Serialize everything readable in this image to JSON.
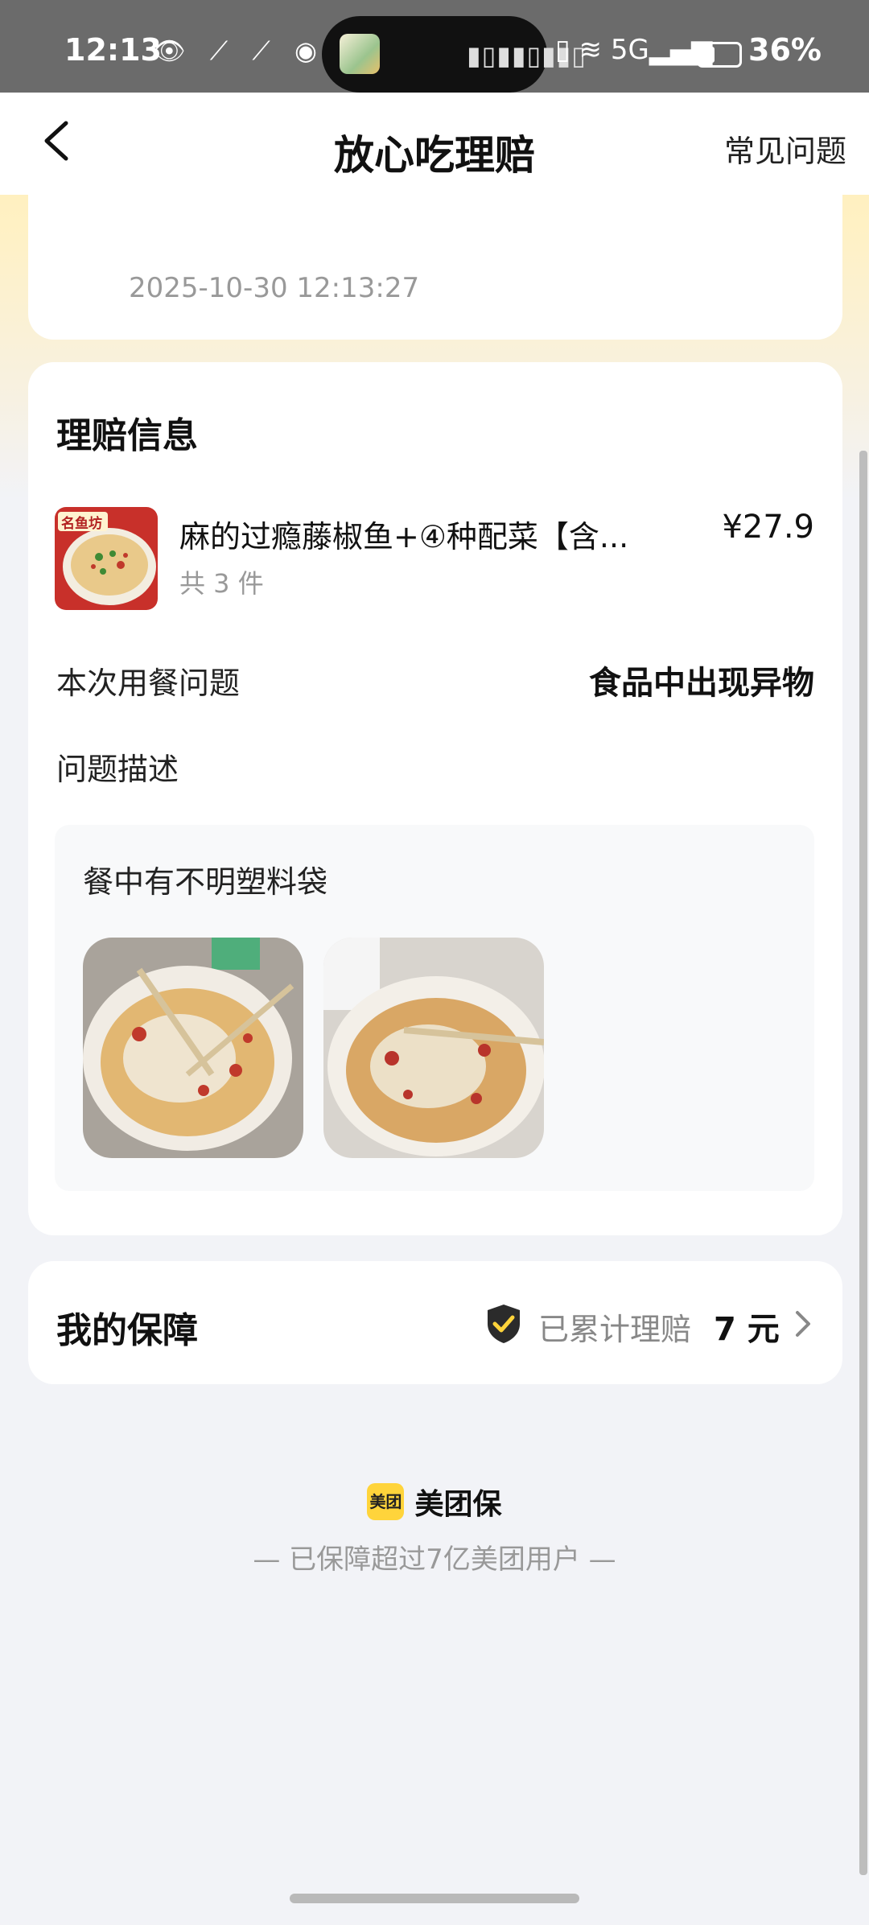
{
  "status_bar": {
    "time": "12:13",
    "battery": "36%",
    "network": "5G"
  },
  "nav": {
    "title": "放心吃理赔",
    "faq": "常见问题"
  },
  "status_card": {
    "timestamp": "2025-10-30 12:13:27"
  },
  "claim": {
    "section_title": "理赔信息",
    "product": {
      "name": "麻的过瘾藤椒鱼+④种配菜【含...",
      "count": "共 3 件",
      "price": "¥27.9",
      "shop_badge": "名鱼坊"
    },
    "issue_label": "本次用餐问题",
    "issue_value": "食品中出现异物",
    "desc_label": "问题描述",
    "desc_text": "餐中有不明塑料袋"
  },
  "guarantee": {
    "title": "我的保障",
    "label": "已累计理赔",
    "amount": "7 元"
  },
  "brand": {
    "badge": "美团",
    "name": "美团保",
    "tagline": "— 已保障超过7亿美团用户 —"
  },
  "colors": {
    "accent": "#ffd43b",
    "header_bg": "#fde9a6",
    "page_bg": "#f2f3f7"
  }
}
